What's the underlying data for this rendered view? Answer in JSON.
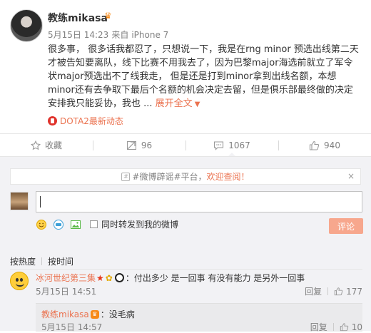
{
  "post": {
    "author": "教练mikasa",
    "date": "5月15日 14:23",
    "source_prefix": "来自",
    "source": "iPhone 7",
    "text": "很多事， 很多话我都忍了，只想说一下，我是在rng minor 预选出线第二天才被告知要离队，线下比赛不用我去了，因为巴黎major海选前就立了军令状major预选出不了线我走， 但是还是打到minor拿到出线名额，本想minor还有去争取下最后个名额的机会决定去留，但是俱乐部最终做的决定安排我只能妥协，我也 ...",
    "expand_label": "展开全文",
    "topic": "DOTA2最新动态"
  },
  "actions": {
    "favorite": "收藏",
    "repost_count": "96",
    "comment_count": "1067",
    "like_count": "940"
  },
  "notice": {
    "tag": "#微博辟谣#平台，",
    "highlight": "欢迎查阅！",
    "close": "×"
  },
  "composer": {
    "input_value": "",
    "repost_label": "同时转发到我的微博",
    "submit_label": "评论"
  },
  "sort": {
    "by_hot": "按热度",
    "by_time": "按时间"
  },
  "comments": [
    {
      "user": "冰河世纪第三集",
      "text": "：付出多少 是一回事 有没有能力 是另外一回事",
      "time": "5月15日 14:51",
      "reply_label": "回复",
      "likes": "177"
    }
  ],
  "reply": {
    "user": "教练mikasa",
    "text": "：没毛病",
    "time": "5月15日 14:57",
    "reply_label": "回复",
    "likes": "10"
  },
  "colors": {
    "accent": "#eb7350",
    "panel": "#f2f2f5",
    "submit_disabled": "#f7a78d"
  },
  "icons": [
    "star-icon",
    "comment-icon",
    "repost-icon",
    "like-icon",
    "emoji-icon",
    "gif-icon",
    "image-icon",
    "close-icon"
  ]
}
